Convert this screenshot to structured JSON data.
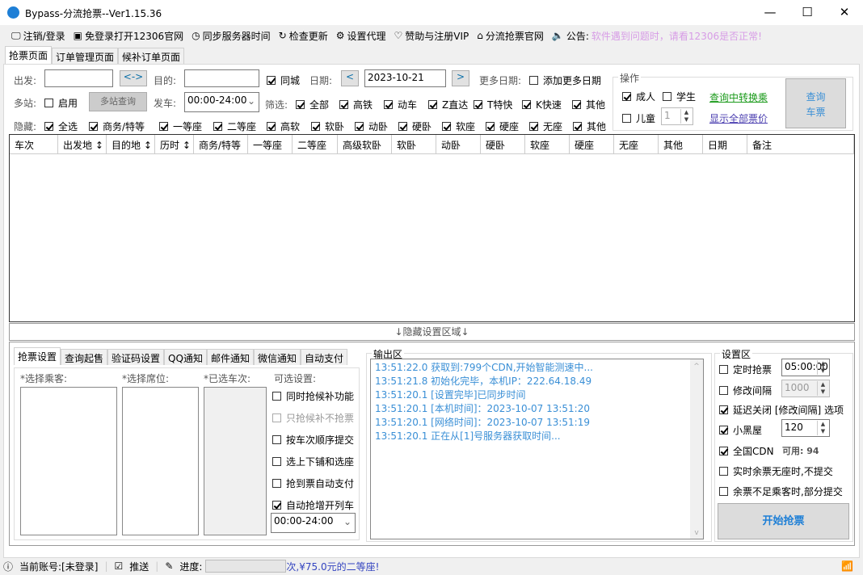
{
  "window": {
    "title": "Bypass-分流抢票--Ver1.15.36",
    "min": "—",
    "max": "☐",
    "close": "✕"
  },
  "toolbar": [
    {
      "icon": "monitor-icon",
      "glyph": "🖵",
      "label": "注销/登录"
    },
    {
      "icon": "window-icon",
      "glyph": "▣",
      "label": "免登录打开12306官网"
    },
    {
      "icon": "clock-icon",
      "glyph": "◷",
      "label": "同步服务器时间"
    },
    {
      "icon": "refresh-icon",
      "glyph": "↻",
      "label": "检查更新"
    },
    {
      "icon": "gear-icon",
      "glyph": "⚙",
      "label": "设置代理"
    },
    {
      "icon": "heart-icon",
      "glyph": "♡",
      "label": "赞助与注册VIP"
    },
    {
      "icon": "home-icon",
      "glyph": "⌂",
      "label": "分流抢票官网"
    }
  ],
  "notice": {
    "label": "公告:",
    "text": "软件遇到问题时，请看12306是否正常!"
  },
  "tabs": [
    "抢票页面",
    "订单管理页面",
    "候补订单页面"
  ],
  "query": {
    "from_label": "出发:",
    "from_value": "",
    "swap": "<->",
    "to_label": "目的:",
    "to_value": "",
    "same_city": "同城",
    "date_label": "日期:",
    "prev": "<",
    "date": "2023-10-21",
    "next": ">",
    "more_dates_label": "更多日期:",
    "add_more_dates": "添加更多日期",
    "multi_label": "多站:",
    "enable": "启用",
    "multi_query": "多站查询",
    "depart_label": "发车:",
    "depart_time": "00:00-24:00",
    "filter_label": "筛选:",
    "filters": [
      "全部",
      "高铁",
      "动车",
      "Z直达",
      "T特快",
      "K快速",
      "其他"
    ],
    "hide_label": "隐藏:",
    "hides": [
      "全选",
      "商务/特等",
      "一等座",
      "二等座",
      "高软",
      "软卧",
      "动卧",
      "硬卧",
      "软座",
      "硬座",
      "无座",
      "其他"
    ]
  },
  "ops": {
    "title": "操作",
    "adult": "成人",
    "student": "学生",
    "child": "儿童",
    "child_count": "1",
    "transfer": "查询中转换乘",
    "show_prices": "显示全部票价",
    "query_btn_1": "查询",
    "query_btn_2": "车票"
  },
  "grid_headers": [
    "车次",
    "出发地 ↕",
    "目的地 ↕",
    "历时 ↕",
    "商务/特等",
    "一等座",
    "二等座",
    "高级软卧",
    "软卧",
    "动卧",
    "硬卧",
    "软座",
    "硬座",
    "无座",
    "其他",
    "日期",
    "备注"
  ],
  "hide_area": "↓隐藏设置区域↓",
  "settings_tabs": [
    "抢票设置",
    "查询起售",
    "验证码设置",
    "QQ通知",
    "邮件通知",
    "微信通知",
    "自动支付"
  ],
  "settings": {
    "passengers": "*选择乘客:",
    "seats": "*选择席位:",
    "trains": "*已选车次:",
    "optional": "可选设置:",
    "options": [
      {
        "label": "同时抢候补功能",
        "checked": false
      },
      {
        "label": "只抢候补不抢票",
        "checked": false,
        "disabled": true
      },
      {
        "label": "按车次顺序提交",
        "checked": false
      },
      {
        "label": "选上下铺和选座",
        "checked": false
      },
      {
        "label": "抢到票自动支付",
        "checked": false
      },
      {
        "label": "自动抢增开列车",
        "checked": true
      }
    ],
    "time_range": "00:00-24:00"
  },
  "output": {
    "title": "输出区",
    "lines": [
      "13:51:22.0  获取到:799个CDN,开始智能测速中...",
      "13:51:21.8  初始化完毕，本机IP：222.64.18.49",
      "13:51:20.1  [设置完毕]已同步时间",
      "13:51:20.1  [本机时间]：2023-10-07 13:51:20",
      "13:51:20.1  [网络时间]：2023-10-07 13:51:19",
      "13:51:20.1  正在从[1]号服务器获取时间..."
    ]
  },
  "setup": {
    "title": "设置区",
    "timed": "定时抢票",
    "timed_value": "05:00:00",
    "interval": "修改间隔",
    "interval_value": "1000",
    "delay_close": "延迟关闭 [修改间隔] 选项",
    "blackroom": "小黑屋",
    "blackroom_value": "120",
    "cdn": "全国CDN",
    "cdn_avail": "可用: 94",
    "no_seat": "实时余票无座时,不提交",
    "partial": "余票不足乘客时,部分提交",
    "start": "开始抢票"
  },
  "status": {
    "account": "当前账号:[未登录]",
    "push": "推送",
    "progress_label": "进度:",
    "progress": 0,
    "marquee": "次,¥75.0元的二等座!"
  },
  "colors": {
    "accent": "#1e7fd6",
    "notice": "#d79ce6",
    "log": "#3a8fd6"
  }
}
